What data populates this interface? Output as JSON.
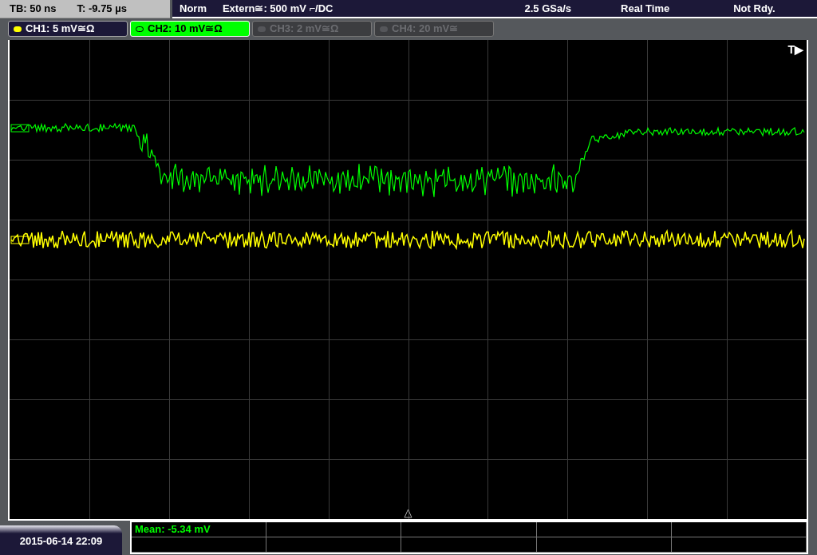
{
  "timebase": {
    "tb": "TB: 50 ns",
    "t": "T: -9.75 µs"
  },
  "trigger": {
    "mode": "Norm",
    "source": "Extern≅: 500 mV ⌐/DC",
    "rate": "2.5 GSa/s",
    "acquisition": "Real Time",
    "status": "Not Rdy."
  },
  "channels": [
    {
      "label": "CH1: 5 mV≅Ω",
      "on": true,
      "selected": false,
      "color": "#ffff00"
    },
    {
      "label": "CH2: 10 mV≅Ω",
      "on": true,
      "selected": true,
      "color": "#00ff00"
    },
    {
      "label": "CH3: 2 mV≅Ω",
      "on": false,
      "selected": false
    },
    {
      "label": "CH4: 20 mV≅",
      "on": false,
      "selected": false
    }
  ],
  "plot": {
    "trigger_label": "T▶"
  },
  "date": "2015-06-14 22:09",
  "measurements": [
    {
      "text": "Mean: -5.34 mV"
    }
  ]
}
